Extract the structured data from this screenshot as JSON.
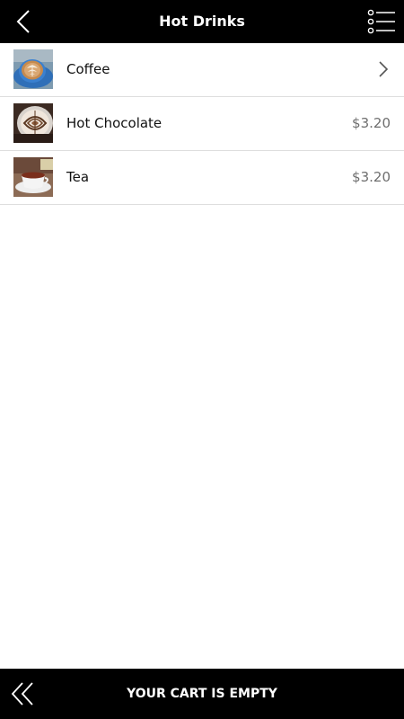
{
  "header": {
    "title": "Hot Drinks",
    "back_icon": "chevron-left-icon",
    "menu_icon": "list-menu-icon"
  },
  "items": [
    {
      "label": "Coffee",
      "price": "",
      "has_submenu": true,
      "thumb": "coffee-latte-art"
    },
    {
      "label": "Hot Chocolate",
      "price": "$3.20",
      "has_submenu": false,
      "thumb": "hot-chocolate-cup"
    },
    {
      "label": "Tea",
      "price": "$3.20",
      "has_submenu": false,
      "thumb": "tea-cup"
    }
  ],
  "footer": {
    "cart_status": "YOUR CART IS EMPTY",
    "collapse_icon": "double-chevron-left-icon"
  },
  "colors": {
    "bar_background": "#000000",
    "bar_text": "#ffffff",
    "row_divider": "#dedede",
    "price_text": "#6e6e6e"
  }
}
